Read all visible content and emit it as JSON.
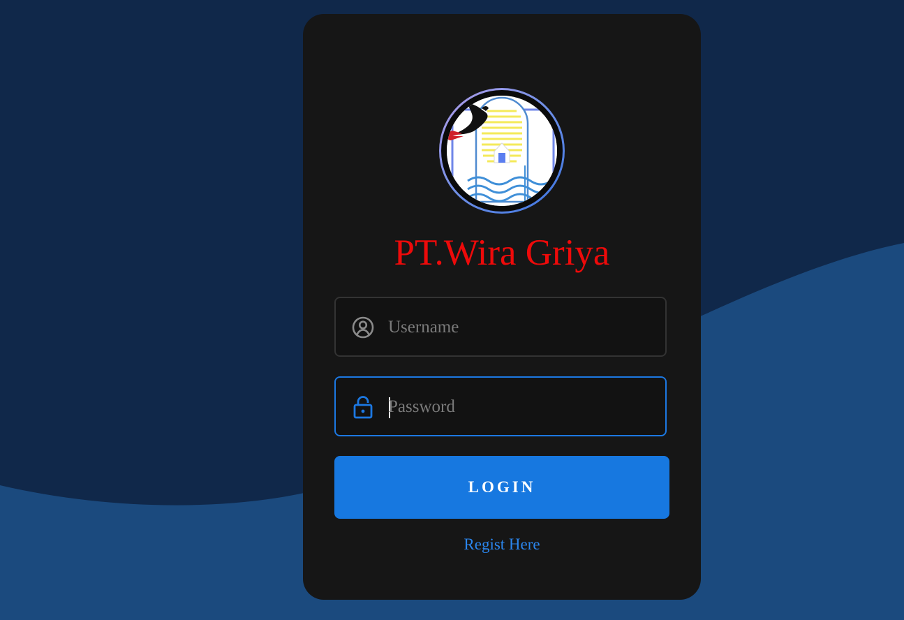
{
  "brand": {
    "title": "PT.Wira Griya",
    "logo_icon": "company-logo-dove-house-waves-icon"
  },
  "form": {
    "username": {
      "placeholder": "Username",
      "value": "",
      "icon": "user-circle-icon"
    },
    "password": {
      "placeholder": "Password",
      "value": "",
      "icon": "lock-icon",
      "focused": true
    },
    "login_label": "LOGIN",
    "register_link": "Regist Here"
  },
  "colors": {
    "background_dark": "#10284a",
    "background_wave": "#1b4a7e",
    "card": "#161616",
    "title": "#ee0a0a",
    "accent": "#1778e0",
    "link": "#2b86ee"
  }
}
